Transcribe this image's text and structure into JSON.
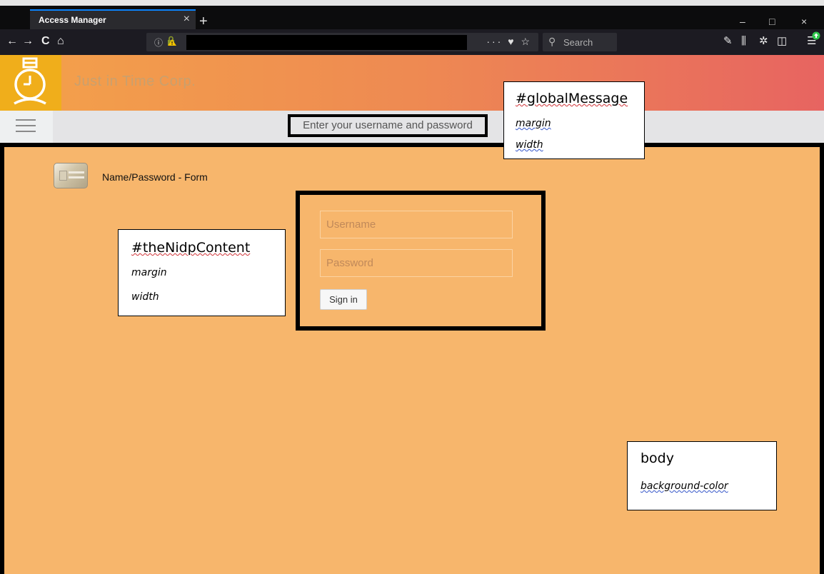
{
  "browser": {
    "tab_title": "Access Manager",
    "tab_close": "×",
    "new_tab": "+",
    "win_minimize": "–",
    "win_maximize": "□",
    "win_close": "×",
    "nav": {
      "back": "←",
      "forward": "→",
      "reload": "C",
      "home": "⌂"
    },
    "url_info_icon": "ⓘ",
    "page_actions": "··· ♥ ☆",
    "search_placeholder": "Search",
    "toolbar_icons": [
      "wrench-icon",
      "library-icon",
      "addon-icon",
      "sidebar-icon",
      "menu-icon"
    ]
  },
  "page": {
    "company_name": "Just in Time Corp.",
    "global_message": "Enter your username and password",
    "card_label": "Name/Password - Form",
    "form": {
      "username_placeholder": "Username",
      "password_placeholder": "Password",
      "signin_label": "Sign in"
    },
    "colors": {
      "brand_start": "#f4a24a",
      "brand_end": "#e76461",
      "logo_bg": "#f0ae1b",
      "content_bg": "#f7b66c"
    }
  },
  "annotations": {
    "global_message": {
      "title": "#globalMessage",
      "props": [
        "margin",
        "width"
      ]
    },
    "nidp_content": {
      "title": "#theNidpContent",
      "props": [
        "margin",
        "width"
      ]
    },
    "body": {
      "title": "body",
      "props": [
        "background-color"
      ]
    }
  }
}
